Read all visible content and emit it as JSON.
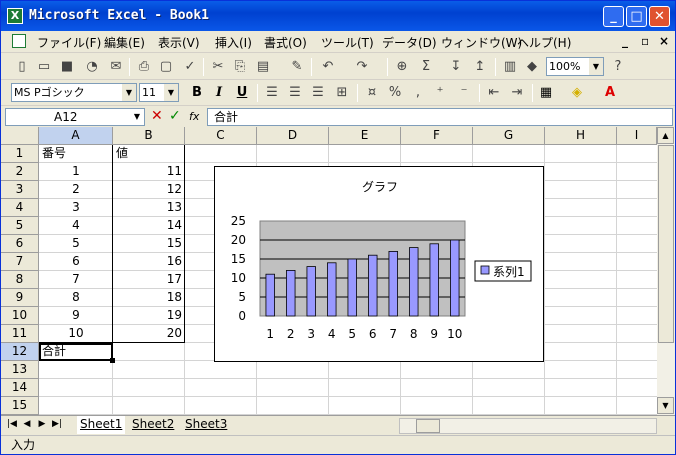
{
  "window": {
    "app_icon": "excel-icon",
    "title": "Microsoft Excel - Book1",
    "minimize": "_",
    "maximize": "□",
    "close": "✕"
  },
  "menu": {
    "items": [
      "ファイル(F)",
      "編集(E)",
      "表示(V)",
      "挿入(I)",
      "書式(O)",
      "ツール(T)",
      "データ(D)",
      "ウィンドウ(W)",
      "ヘルプ(H)"
    ],
    "window_controls": [
      "_",
      "▫",
      "×"
    ]
  },
  "toolbar": {
    "zoom": "100%",
    "font_name": "MS Pゴシック",
    "font_size": "11",
    "bold": "B",
    "italic": "I",
    "underline": "U"
  },
  "formula_bar": {
    "name_box": "A12",
    "cancel": "✕",
    "enter": "✓",
    "fx": "fx",
    "content": "合計"
  },
  "grid": {
    "columns": [
      "A",
      "B",
      "C",
      "D",
      "E",
      "F",
      "G",
      "H",
      "I"
    ],
    "rows": [
      "1",
      "2",
      "3",
      "4",
      "5",
      "6",
      "7",
      "8",
      "9",
      "10",
      "11",
      "12",
      "13",
      "14",
      "15"
    ],
    "header_a1": "番号",
    "header_b1": "値",
    "col_a": [
      "1",
      "2",
      "3",
      "4",
      "5",
      "6",
      "7",
      "8",
      "9",
      "10"
    ],
    "col_b": [
      "11",
      "12",
      "13",
      "14",
      "15",
      "16",
      "17",
      "18",
      "19",
      "20"
    ],
    "a12": "合計"
  },
  "chart_data": {
    "type": "bar",
    "title": "グラフ",
    "categories": [
      "1",
      "2",
      "3",
      "4",
      "5",
      "6",
      "7",
      "8",
      "9",
      "10"
    ],
    "series": [
      {
        "name": "系列1",
        "values": [
          11,
          12,
          13,
          14,
          15,
          16,
          17,
          18,
          19,
          20
        ]
      }
    ],
    "yticks": [
      "25",
      "20",
      "15",
      "10",
      "5",
      "0"
    ],
    "ylim": [
      0,
      25
    ],
    "grid": true,
    "legend": "right",
    "plot_bg": "#C0C0C0",
    "bar_color": "#9999FF"
  },
  "sheets": {
    "tabs": [
      "Sheet1",
      "Sheet2",
      "Sheet3"
    ],
    "active": "Sheet1"
  },
  "status": "入力"
}
